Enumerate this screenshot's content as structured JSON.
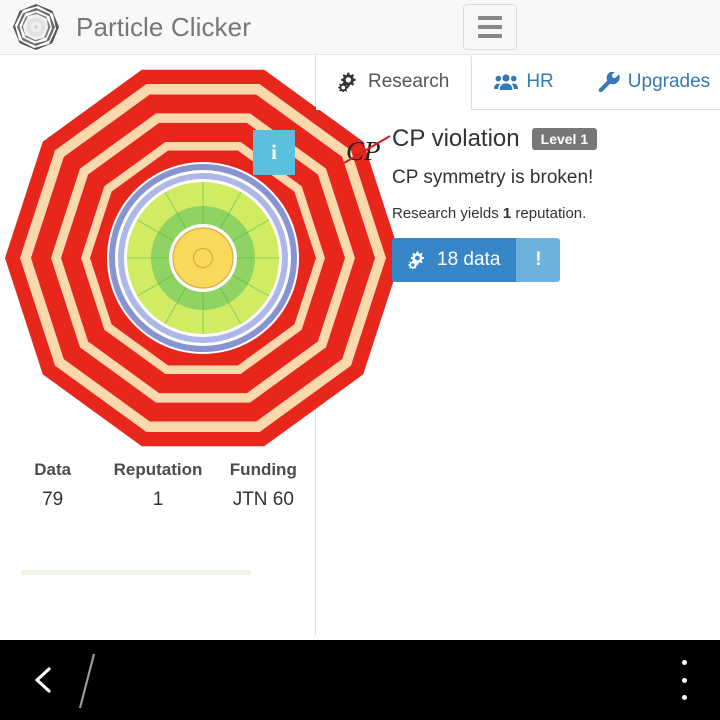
{
  "header": {
    "title": "Particle Clicker",
    "logo_icon": "detector-rings-logo",
    "menu_toggle_icon": "hamburger-icon"
  },
  "detector": {
    "info_button_label": "i",
    "info_icon": "info-icon",
    "colors": {
      "outer_ring": "#e8271c",
      "ring_separator": "#fbd9ad",
      "blue_ring": "#8794d0",
      "light_blue_ring": "#adb8e8",
      "green_outer": "#d1ec63",
      "green_inner": "#8fd364",
      "core": "#f9d95c",
      "core_stroke": "#e0a93a"
    }
  },
  "stats": [
    {
      "label": "Data",
      "value": "79"
    },
    {
      "label": "Reputation",
      "value": "1"
    },
    {
      "label": "Funding",
      "value": "JTN 60"
    }
  ],
  "progress": {
    "percent": 100,
    "color": "#eef4e5"
  },
  "tabs": [
    {
      "label": "Research",
      "icon": "gears-icon",
      "active": true
    },
    {
      "label": "HR",
      "icon": "users-icon",
      "active": false
    },
    {
      "label": "Upgrades",
      "icon": "wrench-icon",
      "active": false
    }
  ],
  "research": {
    "icon": "cp-violation-icon",
    "icon_text": "CP",
    "title": "CP violation",
    "level_badge": "Level 1",
    "description": "CP symmetry is broken!",
    "yield_prefix": "Research yields",
    "yield_amount": "1",
    "yield_suffix": "reputation.",
    "buy_button": {
      "icon": "gears-icon",
      "label": "18 data",
      "flag_label": "!"
    },
    "colors": {
      "buy_main": "#3787c8",
      "buy_flag": "#6cb2dd",
      "badge": "#777777",
      "link": "#337ab7"
    }
  },
  "system_nav": {
    "back_icon": "back-chevron-icon",
    "home_icon": "home-slash-icon",
    "menu_icon": "overflow-menu-icon"
  }
}
